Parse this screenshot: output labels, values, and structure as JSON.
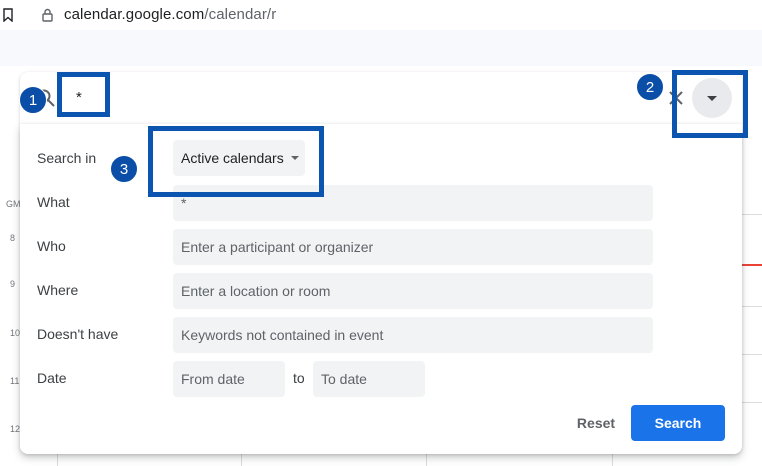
{
  "browser": {
    "url_host": "calendar.google.com",
    "url_path": "/calendar/r"
  },
  "calendar": {
    "timezone_label": "GM",
    "hours": [
      "8",
      "9",
      "10",
      "11",
      "12"
    ]
  },
  "search_bar": {
    "query": "*"
  },
  "advanced_search": {
    "search_in_label": "Search in",
    "search_in_value": "Active calendars",
    "what_label": "What",
    "what_value": "*",
    "who_label": "Who",
    "who_placeholder": "Enter a participant or organizer",
    "where_label": "Where",
    "where_placeholder": "Enter a location or room",
    "doesnt_have_label": "Doesn't have",
    "doesnt_have_placeholder": "Keywords not contained in event",
    "date_label": "Date",
    "from_placeholder": "From date",
    "to_label": "to",
    "to_placeholder": "To date",
    "reset_label": "Reset",
    "search_label": "Search"
  },
  "annotations": {
    "badge_1": "1",
    "badge_2": "2",
    "badge_3": "3",
    "color": "#0b54b0"
  },
  "colors": {
    "primary": "#1a73e8",
    "current_time": "#ea4335"
  }
}
